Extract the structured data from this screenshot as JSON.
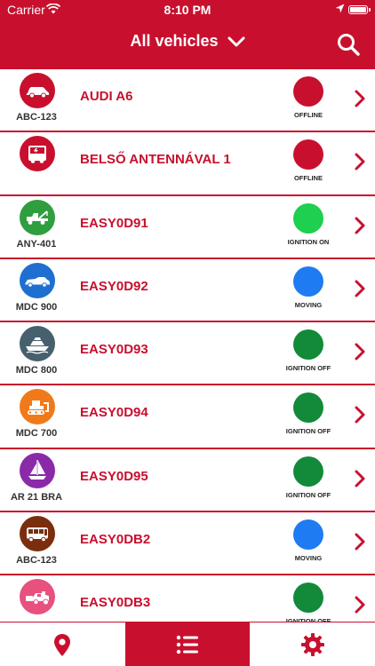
{
  "status_bar": {
    "carrier": "Carrier",
    "time": "8:10 PM"
  },
  "header": {
    "title": "All vehicles"
  },
  "colors": {
    "brand": "#c8102e",
    "offline": "#c8102e",
    "ignition_on": "#1fcf4f",
    "moving": "#1e7bf2",
    "ignition_off": "#128a3a"
  },
  "vehicles": [
    {
      "name": "AUDI A6",
      "plate": "ABC-123",
      "icon": "car-icon",
      "icon_color": "#c8102e",
      "status": "OFFLINE",
      "status_color": "#c8102e"
    },
    {
      "name": "BELSŐ ANTENNÁVAL 1",
      "plate": "",
      "icon": "van-icon",
      "icon_color": "#c8102e",
      "status": "OFFLINE",
      "status_color": "#c8102e"
    },
    {
      "name": "EASY0D91",
      "plate": "ANY-401",
      "icon": "tow-truck-icon",
      "icon_color": "#2e9e3e",
      "status": "IGNITION ON",
      "status_color": "#1fcf4f"
    },
    {
      "name": "EASY0D92",
      "plate": "MDC 900",
      "icon": "limousine-icon",
      "icon_color": "#1e6fd0",
      "status": "MOVING",
      "status_color": "#1e7bf2"
    },
    {
      "name": "EASY0D93",
      "plate": "MDC 800",
      "icon": "yacht-icon",
      "icon_color": "#47606e",
      "status": "IGNITION OFF",
      "status_color": "#128a3a"
    },
    {
      "name": "EASY0D94",
      "plate": "MDC 700",
      "icon": "bulldozer-icon",
      "icon_color": "#f07a1a",
      "status": "IGNITION OFF",
      "status_color": "#128a3a"
    },
    {
      "name": "EASY0D95",
      "plate": "AR 21 BRA",
      "icon": "sailboat-icon",
      "icon_color": "#8a2aa8",
      "status": "IGNITION OFF",
      "status_color": "#128a3a"
    },
    {
      "name": "EASY0DB2",
      "plate": "ABC-123",
      "icon": "bus-icon",
      "icon_color": "#7a2e0e",
      "status": "MOVING",
      "status_color": "#1e7bf2"
    },
    {
      "name": "EASY0DB3",
      "plate": "",
      "icon": "harvester-icon",
      "icon_color": "#e8507e",
      "status": "IGNITION OFF",
      "status_color": "#128a3a"
    }
  ],
  "tabs": [
    {
      "name": "map-pin-icon",
      "active": false
    },
    {
      "name": "list-icon",
      "active": true
    },
    {
      "name": "settings-gear-icon",
      "active": false
    }
  ]
}
